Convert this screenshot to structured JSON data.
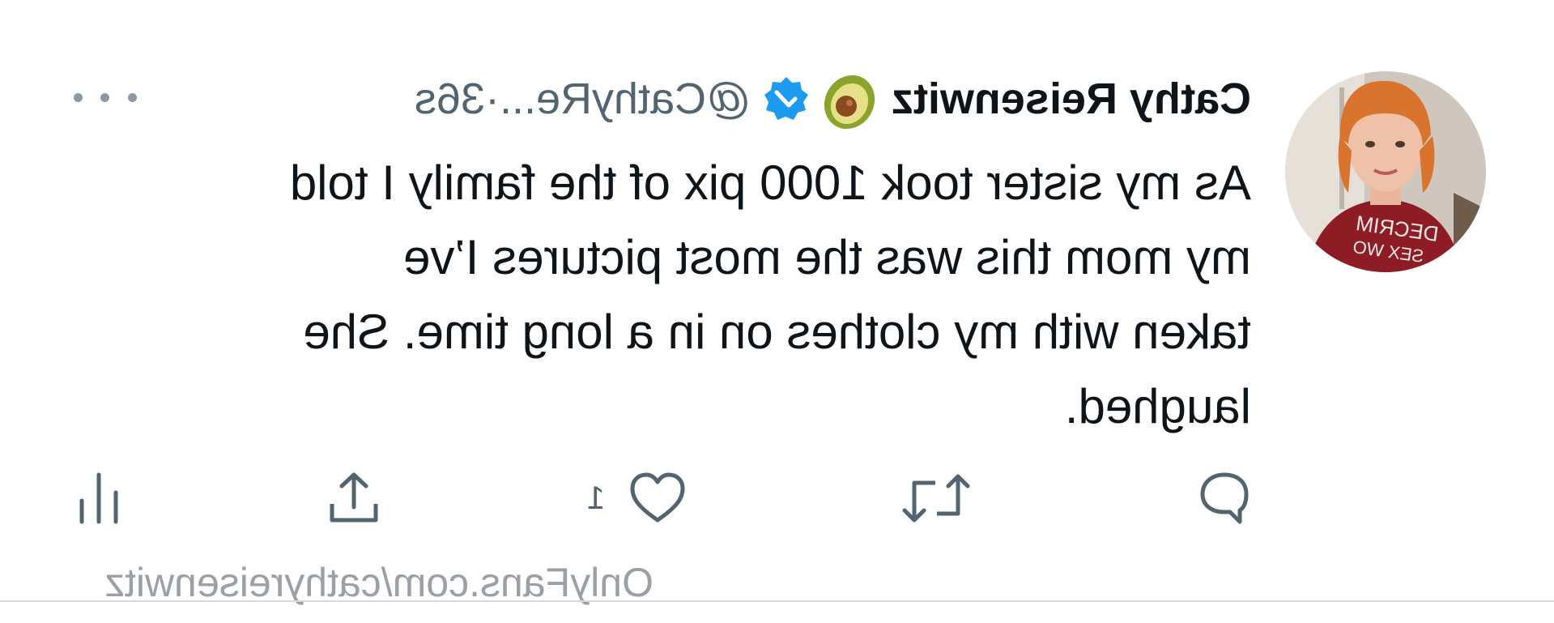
{
  "tweet": {
    "author_name": "Cathy Reisenwitz",
    "author_handle": "@CathyRe...",
    "time_sep": " · ",
    "timestamp": "36s",
    "lines": [
      "As my sister took 1000 pix of the family I told",
      "my mom this was the most pictures I’ve",
      "taken with my clothes on in a long time. She",
      "laughed."
    ],
    "like_count": "1",
    "icons": {
      "avatar": "avatar-photo",
      "emoji": "avocado-icon",
      "badge": "verified-badge-icon",
      "more": "more-options-icon",
      "reply": "reply-icon",
      "retweet": "retweet-icon",
      "like": "heart-icon",
      "share": "share-icon",
      "analytics": "analytics-icon"
    }
  },
  "watermark": "OnlyFans.com/cathyreisenwitz",
  "mirrored": true,
  "colors": {
    "text": "#0f1419",
    "muted": "#536471",
    "verified": "#1d9bf0",
    "watermark": "#9aa0a6"
  }
}
